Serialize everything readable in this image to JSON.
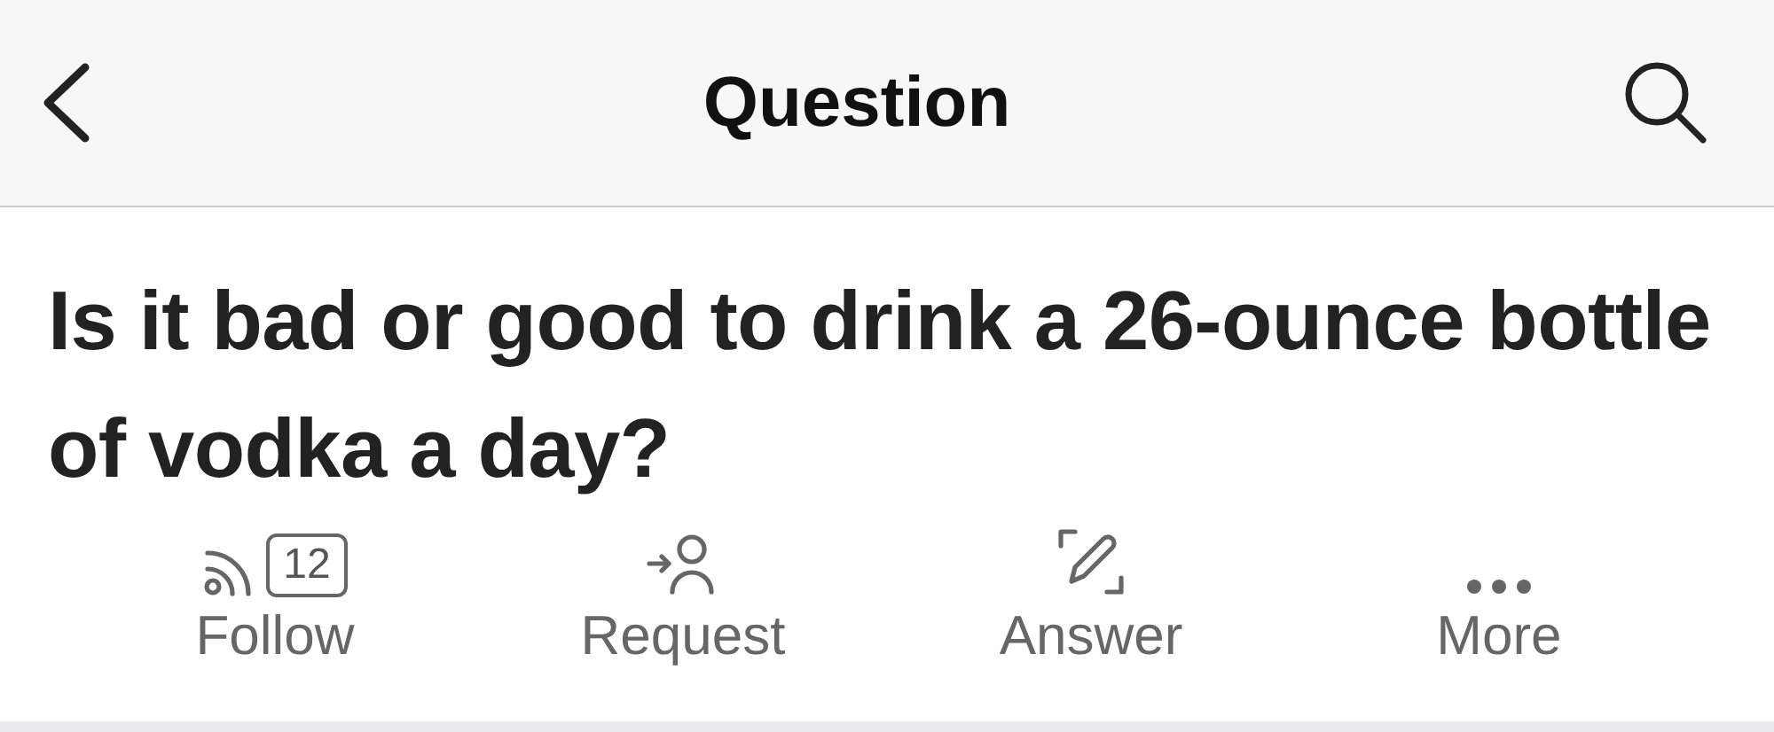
{
  "header": {
    "title": "Question"
  },
  "question": {
    "text": "Is it bad or good to drink a 26-ounce bottle of vodka a day?"
  },
  "actions": [
    {
      "kind": "follow",
      "label": "Follow",
      "count": "12"
    },
    {
      "kind": "request",
      "label": "Request"
    },
    {
      "kind": "answer",
      "label": "Answer"
    },
    {
      "kind": "more",
      "label": "More"
    }
  ]
}
